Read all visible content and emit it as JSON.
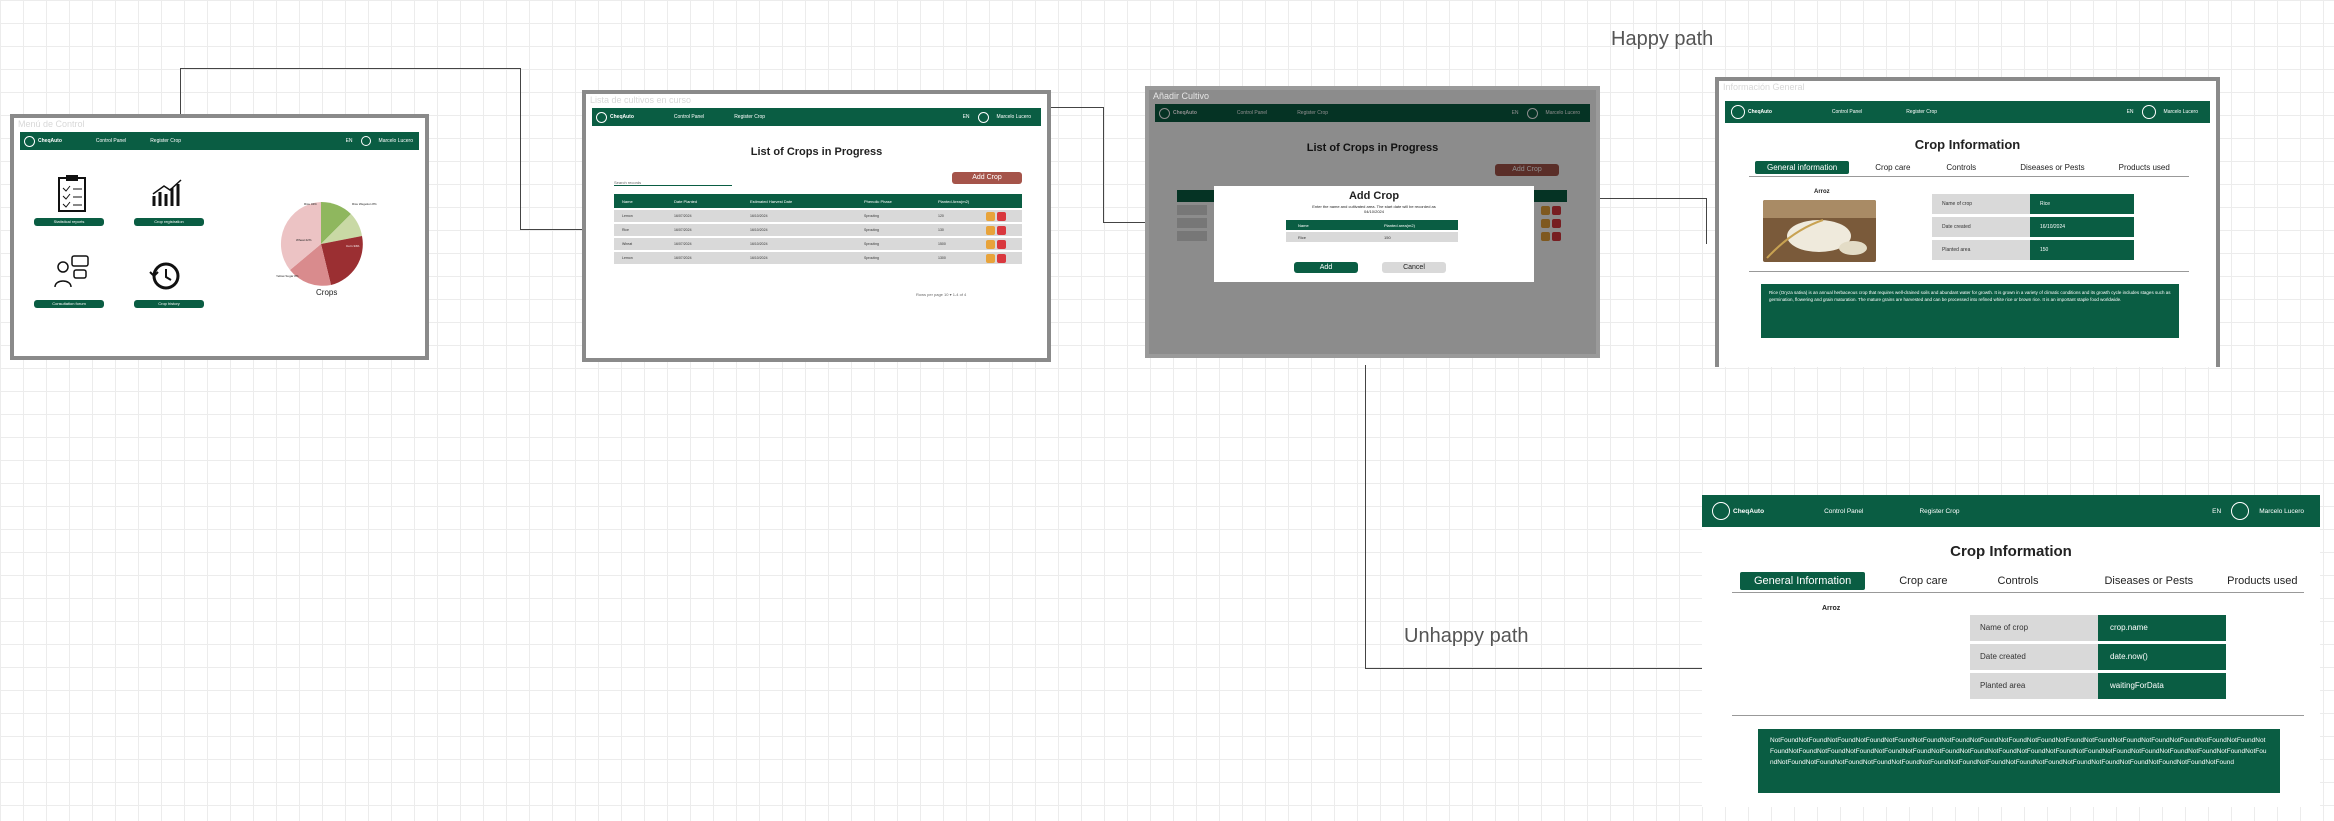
{
  "paths": {
    "happy": "Happy path",
    "unhappy": "Unhappy path"
  },
  "frame1": {
    "title": "Menú de Control",
    "brand": "CheqAuto",
    "nav": [
      "Control Panel",
      "Register Crop"
    ],
    "lang": "EN",
    "user": "Marcelo Lucero",
    "cards": [
      "Statistical reports",
      "Crop registration",
      "Consultation forum",
      "Crop history"
    ],
    "pie_caption": "Crops",
    "pie_labels": [
      "Rice 34%",
      "Rice Wegetion 8%",
      "Yellow Sugar 8%",
      "Wheat 22%",
      "Corn 34%"
    ]
  },
  "frame2": {
    "title": "Lista de cultivos en curso",
    "heading": "List of Crops in Progress",
    "search_placeholder": "Search records",
    "add_btn": "Add Crop",
    "columns": [
      "Name",
      "Date Planted",
      "Estimated Harvest Date",
      "Phenolic Phase",
      "Planted Area(m2)"
    ],
    "rows": [
      [
        "Lemon",
        "16/07/2024",
        "16/10/2024",
        "Sprouting",
        "120"
      ],
      [
        "Rice",
        "16/07/2024",
        "16/10/2024",
        "Sprouting",
        "130"
      ],
      [
        "Wheat",
        "16/07/2024",
        "16/10/2024",
        "Sprouting",
        "1500"
      ],
      [
        "Lemon",
        "16/07/2024",
        "16/10/2024",
        "Sprouting",
        "1300"
      ]
    ],
    "pager": "Rows per page  10 ▾   1-4 of 4"
  },
  "frame3": {
    "title": "Añadir Cultivo",
    "heading": "List of Crops in Progress",
    "add_btn": "Add Crop",
    "modal_title": "Add Crop",
    "modal_text": "Enter the name and cultivated area. The start date will be recorded as 04/10/2024",
    "col_name": "Name",
    "col_area": "Planted area(m2)",
    "name_value": "Rice",
    "area_value": "150",
    "add": "Add",
    "cancel": "Cancel"
  },
  "frame4": {
    "title": "Información General",
    "heading": "Crop Information",
    "tabs": [
      "General information",
      "Crop care",
      "Controls",
      "Diseases or Pests",
      "Products used"
    ],
    "crop_name": "Arroz",
    "fields": [
      {
        "label": "Name of crop",
        "value": "Rice"
      },
      {
        "label": "Date created",
        "value": "16/10/2024"
      },
      {
        "label": "Planted area",
        "value": "150"
      }
    ],
    "description": "Rice (Oryza sativa) is an annual herbaceous crop that requires well-drained soils and abundant water for growth. It is grown in a variety of climatic conditions and its growth cycle includes stages such as germination, flowering and grain maturation. The mature grains are harvested and can be processed into refined white rice or brown rice. It is an important staple food worldwide."
  },
  "frame5": {
    "brand": "CheqAuto",
    "nav": [
      "Control Panel",
      "Register Crop"
    ],
    "lang": "EN",
    "user": "Marcelo Lucero",
    "heading": "Crop Information",
    "tabs": [
      "General Information",
      "Crop care",
      "Controls",
      "Diseases or Pests",
      "Products used"
    ],
    "crop_name": "Arroz",
    "fields": [
      {
        "label": "Name of crop",
        "value": "crop.name"
      },
      {
        "label": "Date created",
        "value": "date.now()"
      },
      {
        "label": "Planted area",
        "value": "waitingForData"
      }
    ],
    "description": "NotFoundNotFoundNotFoundNotFoundNotFoundNotFoundNotFoundNotFoundNotFoundNotFoundNotFoundNotFoundNotFoundNotFoundNotFoundNotFoundNotFoundNotFoundNotFoundNotFoundNotFoundNotFoundNotFoundNotFoundNotFoundNotFoundNotFoundNotFoundNotFoundNotFoundNotFoundNotFoundNotFoundNotFoundNotFoundNotFoundNotFoundNotFoundNotFoundNotFoundNotFoundNotFoundNotFoundNotFoundNotFoundNotFoundNotFoundNotFoundNotFoundNotFoundNotFound"
  },
  "colors": {
    "primary": "#0a5d43",
    "accent": "#a5544a",
    "frame": "#8a8a8a"
  }
}
